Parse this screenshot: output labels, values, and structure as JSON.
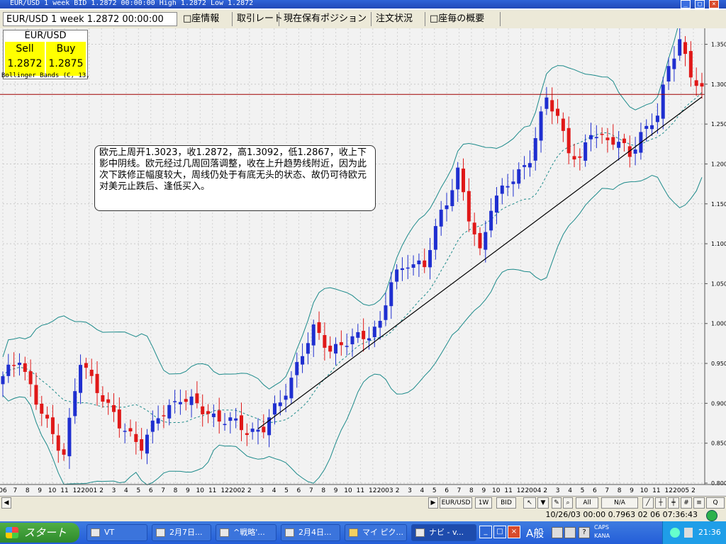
{
  "window": {
    "title": "EUR/USD 1 week BID 1.2872 00:00:00 High 1.2872 Low 1.2872"
  },
  "tabs": [
    {
      "label": "EUR/USD 1 week 1.2872 00:00:00",
      "active": true
    },
    {
      "label": "□座情報"
    },
    {
      "label": "取引レート"
    },
    {
      "label": "現在保有ポジション"
    },
    {
      "label": "注文状況"
    },
    {
      "label": "□座毎の概要"
    }
  ],
  "price_panel": {
    "pair": "EUR/USD",
    "sell_label": "Sell",
    "buy_label": "Buy",
    "sell_value": "1.2872",
    "buy_value": "1.2875",
    "indicator": "Bollinger Bands (C, 13,"
  },
  "note": {
    "text": "欧元上周开1.3023，收1.2872，高1.3092，低1.2867，收上下影中阴线。欧元经过几周回落调整，收在上升趋势线附近，因为此次下跌修正幅度较大，周线仍处于有底无头的状态、故仍可待欧元对美元止跌后、逢低买入。"
  },
  "chart_data": {
    "type": "candlestick",
    "title": "",
    "y_ticks": [
      "1.3500",
      "1.3000",
      "1.2500",
      "1.2000",
      "1.1500",
      "1.1000",
      "1.0500",
      "1.0000",
      "0.9500",
      "0.9000",
      "0.8500",
      "0.8000"
    ],
    "ylim": [
      0.8,
      1.37
    ],
    "current_price_label": "1.2872",
    "x_labels": [
      "06",
      "7",
      "8",
      "9",
      "10",
      "11",
      "12",
      "2001",
      "2",
      "3",
      "4",
      "5",
      "6",
      "7",
      "8",
      "9",
      "10",
      "11",
      "12",
      "2002",
      "2",
      "3",
      "4",
      "5",
      "6",
      "7",
      "8",
      "9",
      "10",
      "11",
      "12",
      "2003",
      "2",
      "3",
      "4",
      "5",
      "6",
      "7",
      "8",
      "9",
      "10",
      "11",
      "12",
      "2004",
      "2",
      "3",
      "4",
      "5",
      "6",
      "7",
      "8",
      "9",
      "10",
      "11",
      "12",
      "2005",
      "2"
    ],
    "grid": true,
    "colors": {
      "up": "#1f2fd0",
      "down": "#e01818",
      "bands": "#1c8a8a",
      "trendline": "#000000",
      "price_line": "#a00000"
    },
    "keypoints": [
      [
        0,
        0.93
      ],
      [
        3,
        0.96
      ],
      [
        6,
        0.9
      ],
      [
        9,
        0.86
      ],
      [
        11,
        0.84
      ],
      [
        14,
        0.95
      ],
      [
        18,
        0.91
      ],
      [
        21,
        0.87
      ],
      [
        25,
        0.85
      ],
      [
        28,
        0.88
      ],
      [
        32,
        0.91
      ],
      [
        36,
        0.89
      ],
      [
        40,
        0.88
      ],
      [
        44,
        0.865
      ],
      [
        47,
        0.87
      ],
      [
        50,
        0.9
      ],
      [
        53,
        0.95
      ],
      [
        56,
        0.99
      ],
      [
        59,
        0.97
      ],
      [
        62,
        0.975
      ],
      [
        65,
        0.985
      ],
      [
        68,
        1.0
      ],
      [
        70,
        1.05
      ],
      [
        73,
        1.08
      ],
      [
        76,
        1.07
      ],
      [
        79,
        1.14
      ],
      [
        82,
        1.19
      ],
      [
        84,
        1.13
      ],
      [
        86,
        1.09
      ],
      [
        88,
        1.15
      ],
      [
        92,
        1.18
      ],
      [
        95,
        1.21
      ],
      [
        98,
        1.28
      ],
      [
        100,
        1.26
      ],
      [
        102,
        1.22
      ],
      [
        104,
        1.2
      ],
      [
        106,
        1.24
      ],
      [
        110,
        1.23
      ],
      [
        113,
        1.21
      ],
      [
        115,
        1.24
      ],
      [
        118,
        1.26
      ],
      [
        120,
        1.32
      ],
      [
        122,
        1.36
      ],
      [
        124,
        1.31
      ],
      [
        126,
        1.29
      ]
    ],
    "trendline": [
      [
        46,
        0.868
      ],
      [
        126,
        1.284
      ]
    ]
  },
  "scroll_controls": {
    "pair_btn": "EUR/USD",
    "period_btn": "1W",
    "side_btn": "BID",
    "all_btn": "All",
    "na_btn": "N/A"
  },
  "status": {
    "text": "10/26/03 00:00   0.7963 02 06 07:36:43"
  },
  "taskbar": {
    "start_label": "スタート",
    "items": [
      "VT",
      "2月7日...",
      "^戦略'...",
      "2月4日...",
      "マイ ピク...",
      "ナビ - v..."
    ],
    "clock": "21:36",
    "ime": "A般",
    "caps": "CAPS",
    "kana": "KANA"
  }
}
